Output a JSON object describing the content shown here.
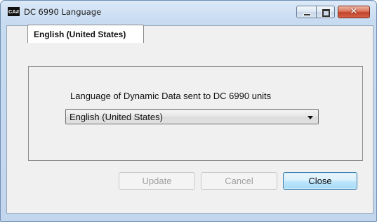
{
  "window": {
    "title": "DC 6990 Language",
    "app_icon_text": "CA#"
  },
  "titlebar_buttons": {
    "close_glyph": "✕"
  },
  "tab": {
    "label": "English (United States)"
  },
  "panel": {
    "label": "Language of Dynamic Data sent to DC 6990 units",
    "select_value": "English (United States)"
  },
  "buttons": {
    "update": "Update",
    "cancel": "Cancel",
    "close": "Close"
  },
  "colors": {
    "frame": "#c7dbf1",
    "close_button": "#c2432a",
    "default_button_border": "#3c7fb1",
    "disabled_text": "#a0a0a0"
  }
}
